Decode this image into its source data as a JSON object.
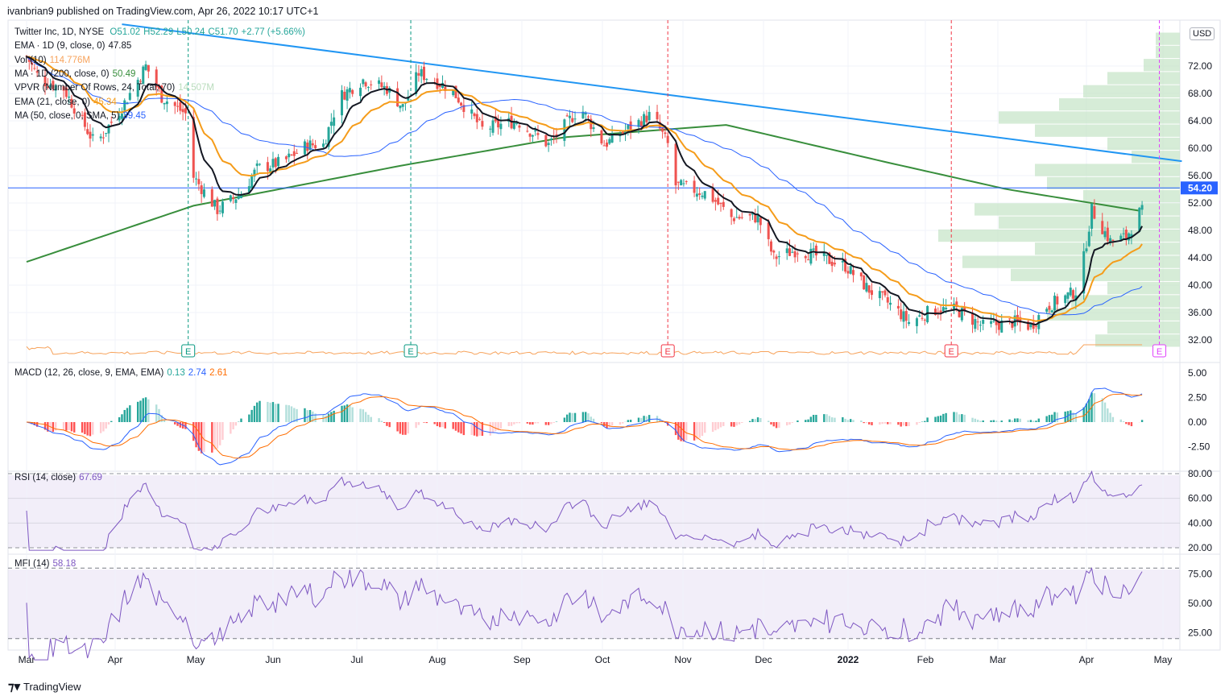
{
  "header": {
    "published": "ivanbrian9 published on TradingView.com, Apr 26, 2022 10:17 UTC+1"
  },
  "legend": {
    "symbol": "Twitter Inc, 1D, NYSE",
    "open": "O51.02",
    "high": "H52.29",
    "low": "L50.24",
    "close": "C51.70",
    "change": "+2.77 (+5.66%)",
    "ema9": "EMA · 1D (9, close, 0)",
    "ema9_val": "47.85",
    "vol": "Vol (10)",
    "vol_val": "114.776M",
    "ma200": "MA · 1D (200, close, 0)",
    "ma200_val": "50.49",
    "vpvr": "VPVR (Number Of Rows, 24, Total, 70)",
    "vpvr_val": "14.507M",
    "ema21": "EMA (21, close, 0)",
    "ema21_val": "45.34",
    "ma50": "MA (50, close, 0, SMA, 5)",
    "ma50_val": "39.45",
    "macd": "MACD (12, 26, close, 9, EMA, EMA)",
    "macd_hist": "0.13",
    "macd_line": "2.74",
    "macd_signal": "2.61",
    "rsi": "RSI (14, close)",
    "rsi_val": "67.69",
    "mfi": "MFI (14)",
    "mfi_val": "58.18"
  },
  "currency": "USD",
  "last_price": "54.20",
  "footer": {
    "brand": "TradingView"
  },
  "colors": {
    "up": "#26a69a",
    "down": "#ef5350",
    "ema9": "#131722",
    "ema21": "#f59c1a",
    "ma50": "#2962ff",
    "ma200": "#388e3c",
    "trend": "#2196f3",
    "vpvr": "#c8e6c9",
    "rsi": "#7e57c2"
  },
  "chart_data": {
    "type": "candlestick",
    "title": "Twitter Inc, 1D, NYSE",
    "x_tick_labels": [
      "Mar",
      "Apr",
      "May",
      "Jun",
      "Jul",
      "Aug",
      "Sep",
      "Oct",
      "Nov",
      "Dec",
      "2022",
      "Feb",
      "Mar",
      "Apr",
      "May"
    ],
    "price_ticks": [
      "72.00",
      "68.00",
      "64.00",
      "60.00",
      "56.00",
      "52.00",
      "48.00",
      "44.00",
      "40.00",
      "36.00",
      "32.00"
    ],
    "ylim": [
      30,
      78
    ],
    "close_keypoints_day_price": [
      [
        0,
        73.4
      ],
      [
        5,
        70
      ],
      [
        14,
        68.7
      ],
      [
        26,
        60.5
      ],
      [
        36,
        66
      ],
      [
        45,
        72
      ],
      [
        51,
        67.5
      ],
      [
        60,
        65
      ],
      [
        63,
        55.8
      ],
      [
        72,
        51
      ],
      [
        81,
        53.4
      ],
      [
        87,
        57
      ],
      [
        97,
        58
      ],
      [
        106,
        60.5
      ],
      [
        112,
        60.5
      ],
      [
        118,
        67.5
      ],
      [
        127,
        70
      ],
      [
        136,
        68.7
      ],
      [
        142,
        66
      ],
      [
        148,
        71
      ],
      [
        160,
        68.7
      ],
      [
        172,
        62.8
      ],
      [
        185,
        64
      ],
      [
        197,
        60.5
      ],
      [
        209,
        66
      ],
      [
        218,
        60.5
      ],
      [
        227,
        62.8
      ],
      [
        236,
        65
      ],
      [
        242,
        60.5
      ],
      [
        245,
        54.6
      ],
      [
        257,
        53.4
      ],
      [
        266,
        49.9
      ],
      [
        276,
        49.9
      ],
      [
        282,
        44
      ],
      [
        291,
        45.2
      ],
      [
        300,
        44
      ],
      [
        309,
        42.8
      ],
      [
        318,
        39.3
      ],
      [
        327,
        36.9
      ],
      [
        333,
        34.6
      ],
      [
        342,
        36.4
      ],
      [
        351,
        36.4
      ],
      [
        361,
        34
      ],
      [
        373,
        34.6
      ],
      [
        379,
        34
      ],
      [
        385,
        36.9
      ],
      [
        397,
        39.3
      ],
      [
        402,
        51
      ],
      [
        409,
        46.4
      ],
      [
        415,
        47
      ],
      [
        421,
        51.3
      ]
    ],
    "ma200_keypoints_day_price": [
      [
        0,
        43.4
      ],
      [
        63,
        51.6
      ],
      [
        142,
        57.5
      ],
      [
        203,
        61.6
      ],
      [
        264,
        63.4
      ],
      [
        324,
        58
      ],
      [
        370,
        54
      ],
      [
        421,
        50.8
      ]
    ],
    "trendline": [
      [
        36,
        78.1
      ],
      [
        436,
        58.1
      ]
    ],
    "horizontal_level": 54.2,
    "earnings": [
      {
        "day": 61,
        "label": "E",
        "type": "past-beat"
      },
      {
        "day": 145,
        "label": "E",
        "type": "past-beat"
      },
      {
        "day": 242,
        "label": "E",
        "type": "past-miss"
      },
      {
        "day": 349,
        "label": "E",
        "type": "past-miss"
      },
      {
        "day": 426,
        "label": "E",
        "type": "upcoming"
      }
    ],
    "vpvr_rows_relative": [
      0.35,
      0.3,
      0.55,
      0.45,
      0.3,
      0.7,
      0.9,
      0.6,
      1.0,
      0.75,
      0.85,
      0.4,
      0.55,
      0.6,
      0.2,
      0.3,
      0.6,
      0.75,
      0.5,
      0.4,
      0.3,
      0.15,
      0.1,
      0.1
    ],
    "macd_ticks": [
      "5.00",
      "2.50",
      "0.00",
      "-2.50"
    ],
    "rsi_ticks": [
      "80.00",
      "60.00",
      "40.00",
      "20.00"
    ],
    "mfi_ticks": [
      "75.00",
      "50.00",
      "25.00"
    ]
  }
}
